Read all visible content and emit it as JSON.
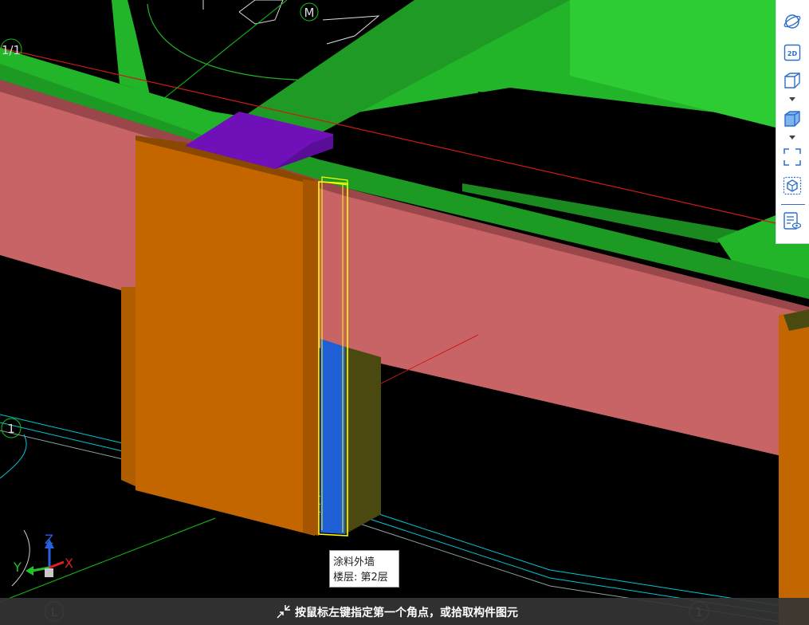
{
  "viewport": {
    "grid_labels": {
      "m": "M",
      "one_over_one": "1/1",
      "one_left": "1",
      "l_bottom": "L",
      "one_bottom": "1"
    },
    "axes": {
      "z": "Z",
      "y": "Y",
      "x": "X"
    }
  },
  "colors": {
    "background": "#000000",
    "slab": "#22b52a",
    "slab_dark": "#1f8a25",
    "beam": "#c86465",
    "beam_top": "#a0484a",
    "column": "#c36600",
    "opening": "#6f10b8",
    "selected_wall": "#1e5fd6",
    "selection_outline": "#ffff00",
    "grid_green": "#0f7a1a",
    "grid_red": "#cc1a1a",
    "grid_cyan": "#00c8d8"
  },
  "toolbar": {
    "buttons": [
      {
        "name": "orbit-icon",
        "tooltip": ""
      },
      {
        "name": "2d-icon",
        "label": "2D"
      },
      {
        "name": "view-cube-icon"
      },
      {
        "name": "render-mode-icon"
      },
      {
        "name": "zoom-extents-icon"
      },
      {
        "name": "component-view-icon"
      },
      {
        "name": "property-view-icon"
      }
    ]
  },
  "tooltip": {
    "component": "涂料外墙",
    "floor": "楼层: 第2层"
  },
  "status": {
    "prompt": "按鼠标左键指定第一个角点，或拾取构件图元"
  }
}
